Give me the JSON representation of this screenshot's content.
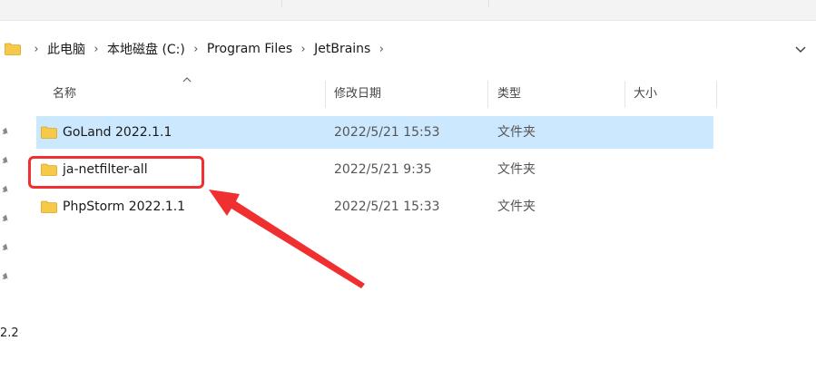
{
  "breadcrumbs": [
    "此电脑",
    "本地磁盘 (C:)",
    "Program Files",
    "JetBrains"
  ],
  "columns": {
    "name": "名称",
    "modified": "修改日期",
    "type": "类型",
    "size": "大小"
  },
  "rows": [
    {
      "name": "GoLand 2022.1.1",
      "modified": "2022/5/21 15:53",
      "type": "文件夹",
      "selected": true
    },
    {
      "name": "ja-netfilter-all",
      "modified": "2022/5/21 9:35",
      "type": "文件夹",
      "selected": false,
      "highlighted": true
    },
    {
      "name": "PhpStorm 2022.1.1",
      "modified": "2022/5/21 15:33",
      "type": "文件夹",
      "selected": false
    }
  ],
  "left_pane": {
    "partial_text": "2.2"
  },
  "colors": {
    "folder": "#f7c948",
    "selection": "#cce8ff",
    "annotation": "#f03030"
  },
  "icons": [
    "folder-icon",
    "chevron-right-icon",
    "chevron-down-icon",
    "sort-up-icon",
    "pin-icon"
  ]
}
